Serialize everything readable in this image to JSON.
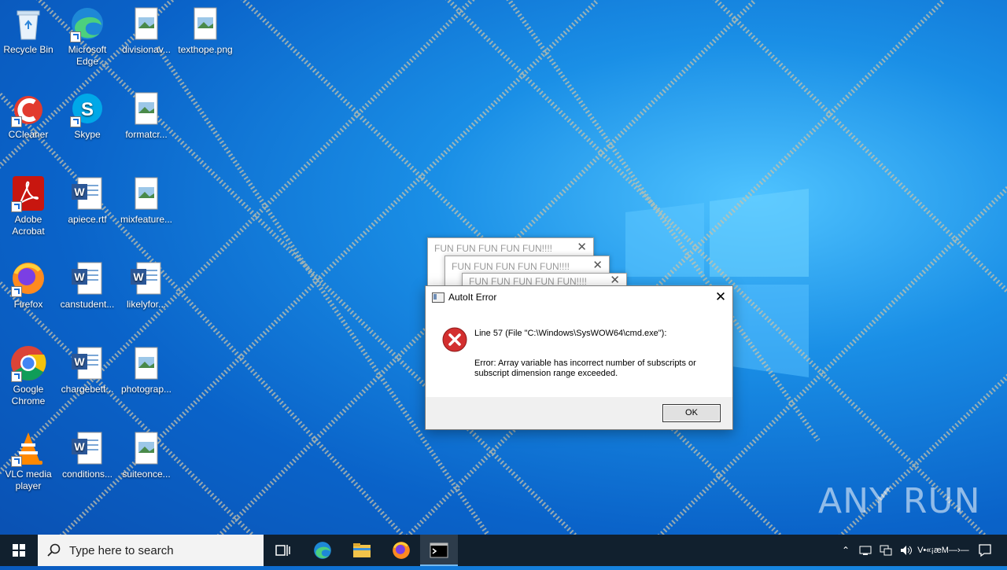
{
  "desktop_icons": [
    {
      "label": "Recycle Bin"
    },
    {
      "label": "Microsoft Edge"
    },
    {
      "label": "divisionav..."
    },
    {
      "label": "texthope.png"
    },
    {
      "label": "CCleaner"
    },
    {
      "label": "Skype"
    },
    {
      "label": "formatcr..."
    },
    {
      "label": "Adobe Acrobat"
    },
    {
      "label": "apiece.rtf"
    },
    {
      "label": "mixfeature..."
    },
    {
      "label": "Firefox"
    },
    {
      "label": "canstudent..."
    },
    {
      "label": "likelyfor..."
    },
    {
      "label": "Google Chrome"
    },
    {
      "label": "chargebett..."
    },
    {
      "label": "photograp..."
    },
    {
      "label": "VLC media player"
    },
    {
      "label": "conditions..."
    },
    {
      "label": "suiteonce..."
    }
  ],
  "background_windows": [
    {
      "title": "FUN FUN FUN FUN FUN!!!!"
    },
    {
      "title": "FUN FUN FUN FUN FUN!!!!"
    },
    {
      "title": "FUN FUN FUN FUN FUN!!!!"
    }
  ],
  "dialog": {
    "title": "AutoIt Error",
    "line": "Line 57  (File \"C:\\Windows\\SysWOW64\\cmd.exe\"):",
    "error": "Error: Array variable has incorrect number of subscripts or subscript dimension range exceeded.",
    "ok_label": "OK"
  },
  "taskbar": {
    "search_placeholder": "Type here to search",
    "tray_text": "V•«¡æM—›—"
  },
  "watermark": "ANY RUN",
  "colors": {
    "desktop_blue": "#0a63c9",
    "taskbar": "#11202e",
    "error_red": "#d32f2f"
  }
}
